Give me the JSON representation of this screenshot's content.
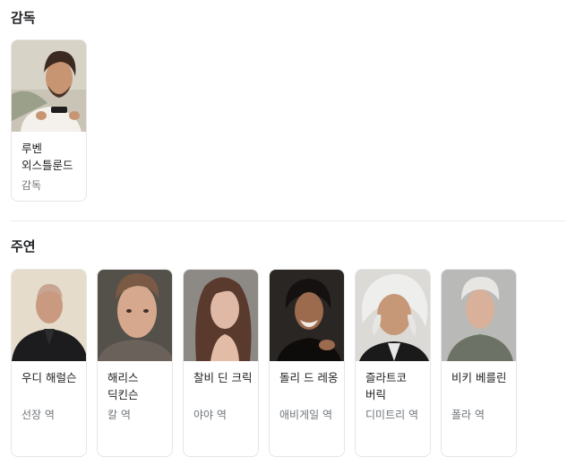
{
  "director_section": {
    "title": "감독",
    "people": [
      {
        "name": "루벤 외스틀룬드",
        "role": "감독"
      }
    ]
  },
  "cast_section": {
    "title": "주연",
    "people": [
      {
        "name": "우디 해럴슨",
        "role": "선장 역"
      },
      {
        "name": "해리스 딕킨슨",
        "role": "칼 역"
      },
      {
        "name": "찰비 딘 크릭",
        "role": "야야 역"
      },
      {
        "name": "돌리 드 레옹",
        "role": "애비게일 역"
      },
      {
        "name": "즐라트코 버릭",
        "role": "디미트리 역"
      },
      {
        "name": "비키 베를린",
        "role": "폴라 역"
      }
    ]
  }
}
